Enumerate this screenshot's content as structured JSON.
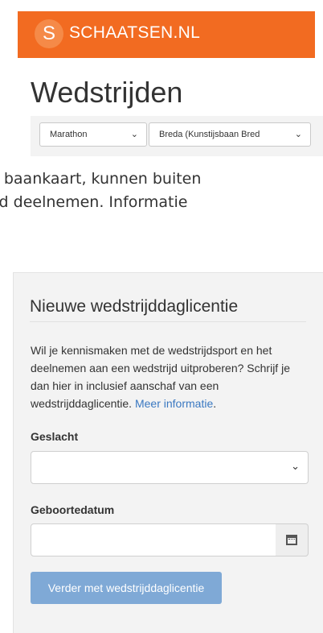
{
  "brand": {
    "logo_letter": "S",
    "name": "SCHAATSEN.NL",
    "bar_color": "#f26b21"
  },
  "page": {
    "title": "Wedstrijden"
  },
  "filters": {
    "discipline": "Marathon",
    "location": "Breda (Kunstijsbaan Bred"
  },
  "intro": {
    "line1": "r baankaart, kunnen buiten",
    "line2": "ijd deelnemen. Informatie"
  },
  "license_panel": {
    "title": "Nieuwe wedstrijddaglicentie",
    "text": "Wil je kennismaken met de wedstrijdsport en het deelnemen aan een wedstrijd uitproberen? Schrijf je dan hier in inclusief aanschaf van een wedstrijddaglicentie.",
    "more_link": "Meer informatie",
    "text_end": ".",
    "gender_label": "Geslacht",
    "gender_value": "",
    "birthdate_label": "Geboortedatum",
    "birthdate_value": "",
    "submit_label": "Verder met wedstrijddaglicentie",
    "link_color": "#3a78c1",
    "button_color": "#7fa9d6"
  },
  "icons": {
    "chevron": "chevron-down-icon",
    "calendar": "calendar-icon"
  }
}
